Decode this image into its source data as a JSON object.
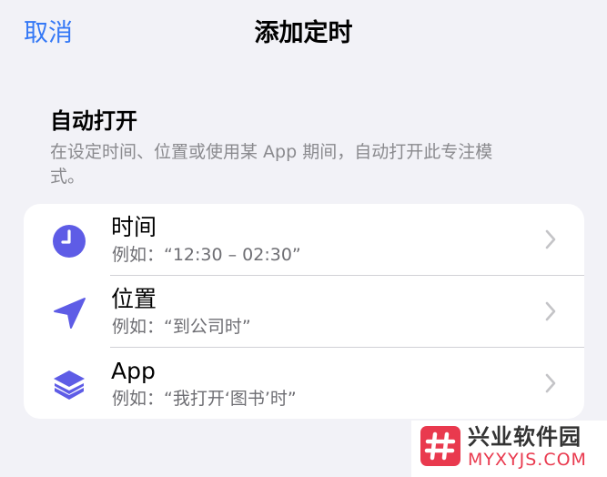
{
  "nav": {
    "cancel_label": "取消",
    "title": "添加定时"
  },
  "header": {
    "title": "自动打开",
    "description": "在设定时间、位置或使用某 App 期间，自动打开此专注模式。"
  },
  "options": [
    {
      "icon": "clock-icon",
      "title": "时间",
      "subtitle": "例如：“12:30 – 02:30”"
    },
    {
      "icon": "location-arrow-icon",
      "title": "位置",
      "subtitle": "例如：“到公司时”"
    },
    {
      "icon": "app-layers-icon",
      "title": "App",
      "subtitle": "例如：“我打开‘图书’时”"
    }
  ],
  "colors": {
    "accent": "#3478F6",
    "icon": "#5E5CE6",
    "background": "#F2F2F7",
    "card": "#FFFFFF"
  },
  "watermark": {
    "text": "兴业软件园",
    "sub": "MYXYJS.COM"
  }
}
